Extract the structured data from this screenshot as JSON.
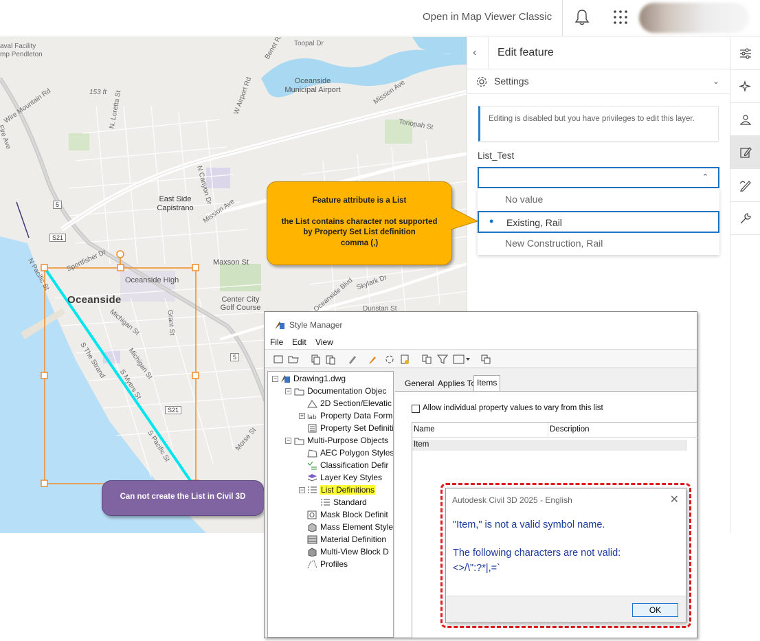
{
  "topbar": {
    "open_link": "Open in Map Viewer Classic"
  },
  "map": {
    "labels": {
      "naval": "aval Facility",
      "pendleton": "mp Pendleton",
      "wire_mountain": "Wire Mountain Rd",
      "fire_ave": "Fire Ave",
      "north_st": "N. Loretta St",
      "elev": "153 ft",
      "w_airport": "W Airport Rd",
      "benet": "Benet Rd",
      "toopal": "Toopal Dr",
      "airport": "Oceanside Municipal Airport",
      "mission_ave_top": "Mission Ave",
      "tonopah": "Tonopah St",
      "canyon": "N Canyon Dr",
      "east_side": "East Side Capistrano",
      "mission_ave_mid": "Mission Ave",
      "sportfisher": "Sportfisher Dr",
      "oceanside_high": "Oceanside High",
      "oceanside": "Oceanside",
      "maxson": "Maxson St",
      "n_pacific": "N Pacific St",
      "michigan1": "Michigan St",
      "michigan2": "Michigan St",
      "grant": "Grant St",
      "center_city": "Center City Golf Course",
      "skylark": "Skylark Dr",
      "strand": "S The Strand",
      "myers": "S Myers St",
      "s_pacific": "S Pacific St",
      "morse": "Morse St",
      "oceanside_blvd": "Oceanside Blvd",
      "dunstan": "Dunstan St",
      "shield_5a": "5",
      "shield_5b": "5",
      "shield_s21a": "S21",
      "shield_s21b": "S21"
    }
  },
  "panel": {
    "title": "Edit feature",
    "settings": "Settings",
    "notice": "Editing is disabled but you have privileges to edit this layer.",
    "field_label": "List_Test",
    "select_value": "",
    "options": [
      "No value",
      "Existing, Rail",
      "New Construction, Rail"
    ]
  },
  "callouts": {
    "top_line1": "Feature attribute is a List",
    "top_line2": "the List contains character not supported",
    "top_line3": "by Property Set List definition",
    "top_line4": "comma (,)",
    "bottom": "Can not create the List in Civil 3D"
  },
  "style_manager": {
    "title": "Style Manager",
    "menu": [
      "File",
      "Edit",
      "View"
    ],
    "tree": {
      "root": "Drawing1.dwg",
      "documentation": "Documentation Objec",
      "section": "2D Section/Elevatic",
      "property_data": "Property Data Form",
      "property_set": "Property Set Definiti",
      "multi_purpose": "Multi-Purpose Objects",
      "aec_polygon": "AEC Polygon Styles",
      "classification": "Classification Defir",
      "layer_key": "Layer Key Styles",
      "list_definitions": "List Definitions",
      "standard": "Standard",
      "mask_block": "Mask Block Definit",
      "mass_element": "Mass Element Style",
      "material": "Material Definition",
      "multi_view": "Multi-View Block D",
      "profiles": "Profiles"
    },
    "tabs": [
      "General",
      "Applies To",
      "Items"
    ],
    "checkbox": "Allow individual property values to vary from this list",
    "columns": [
      "Name",
      "Description"
    ],
    "row": "Item"
  },
  "dialog": {
    "title": "Autodesk Civil 3D 2025 - English",
    "line1": "\"Item,\" is not a valid symbol name.",
    "line2": "The following characters are not valid:",
    "line3": "<>/\\\":?*|,=`",
    "ok": "OK"
  },
  "colors": {
    "accent": "#1e73c0",
    "callout_orange": "#ffb400",
    "callout_purple": "#8064a2",
    "highlight": "#ffff33",
    "error_border": "#e01e1e",
    "selection_line": "#00e5ee",
    "selection_box": "#f08c28"
  }
}
